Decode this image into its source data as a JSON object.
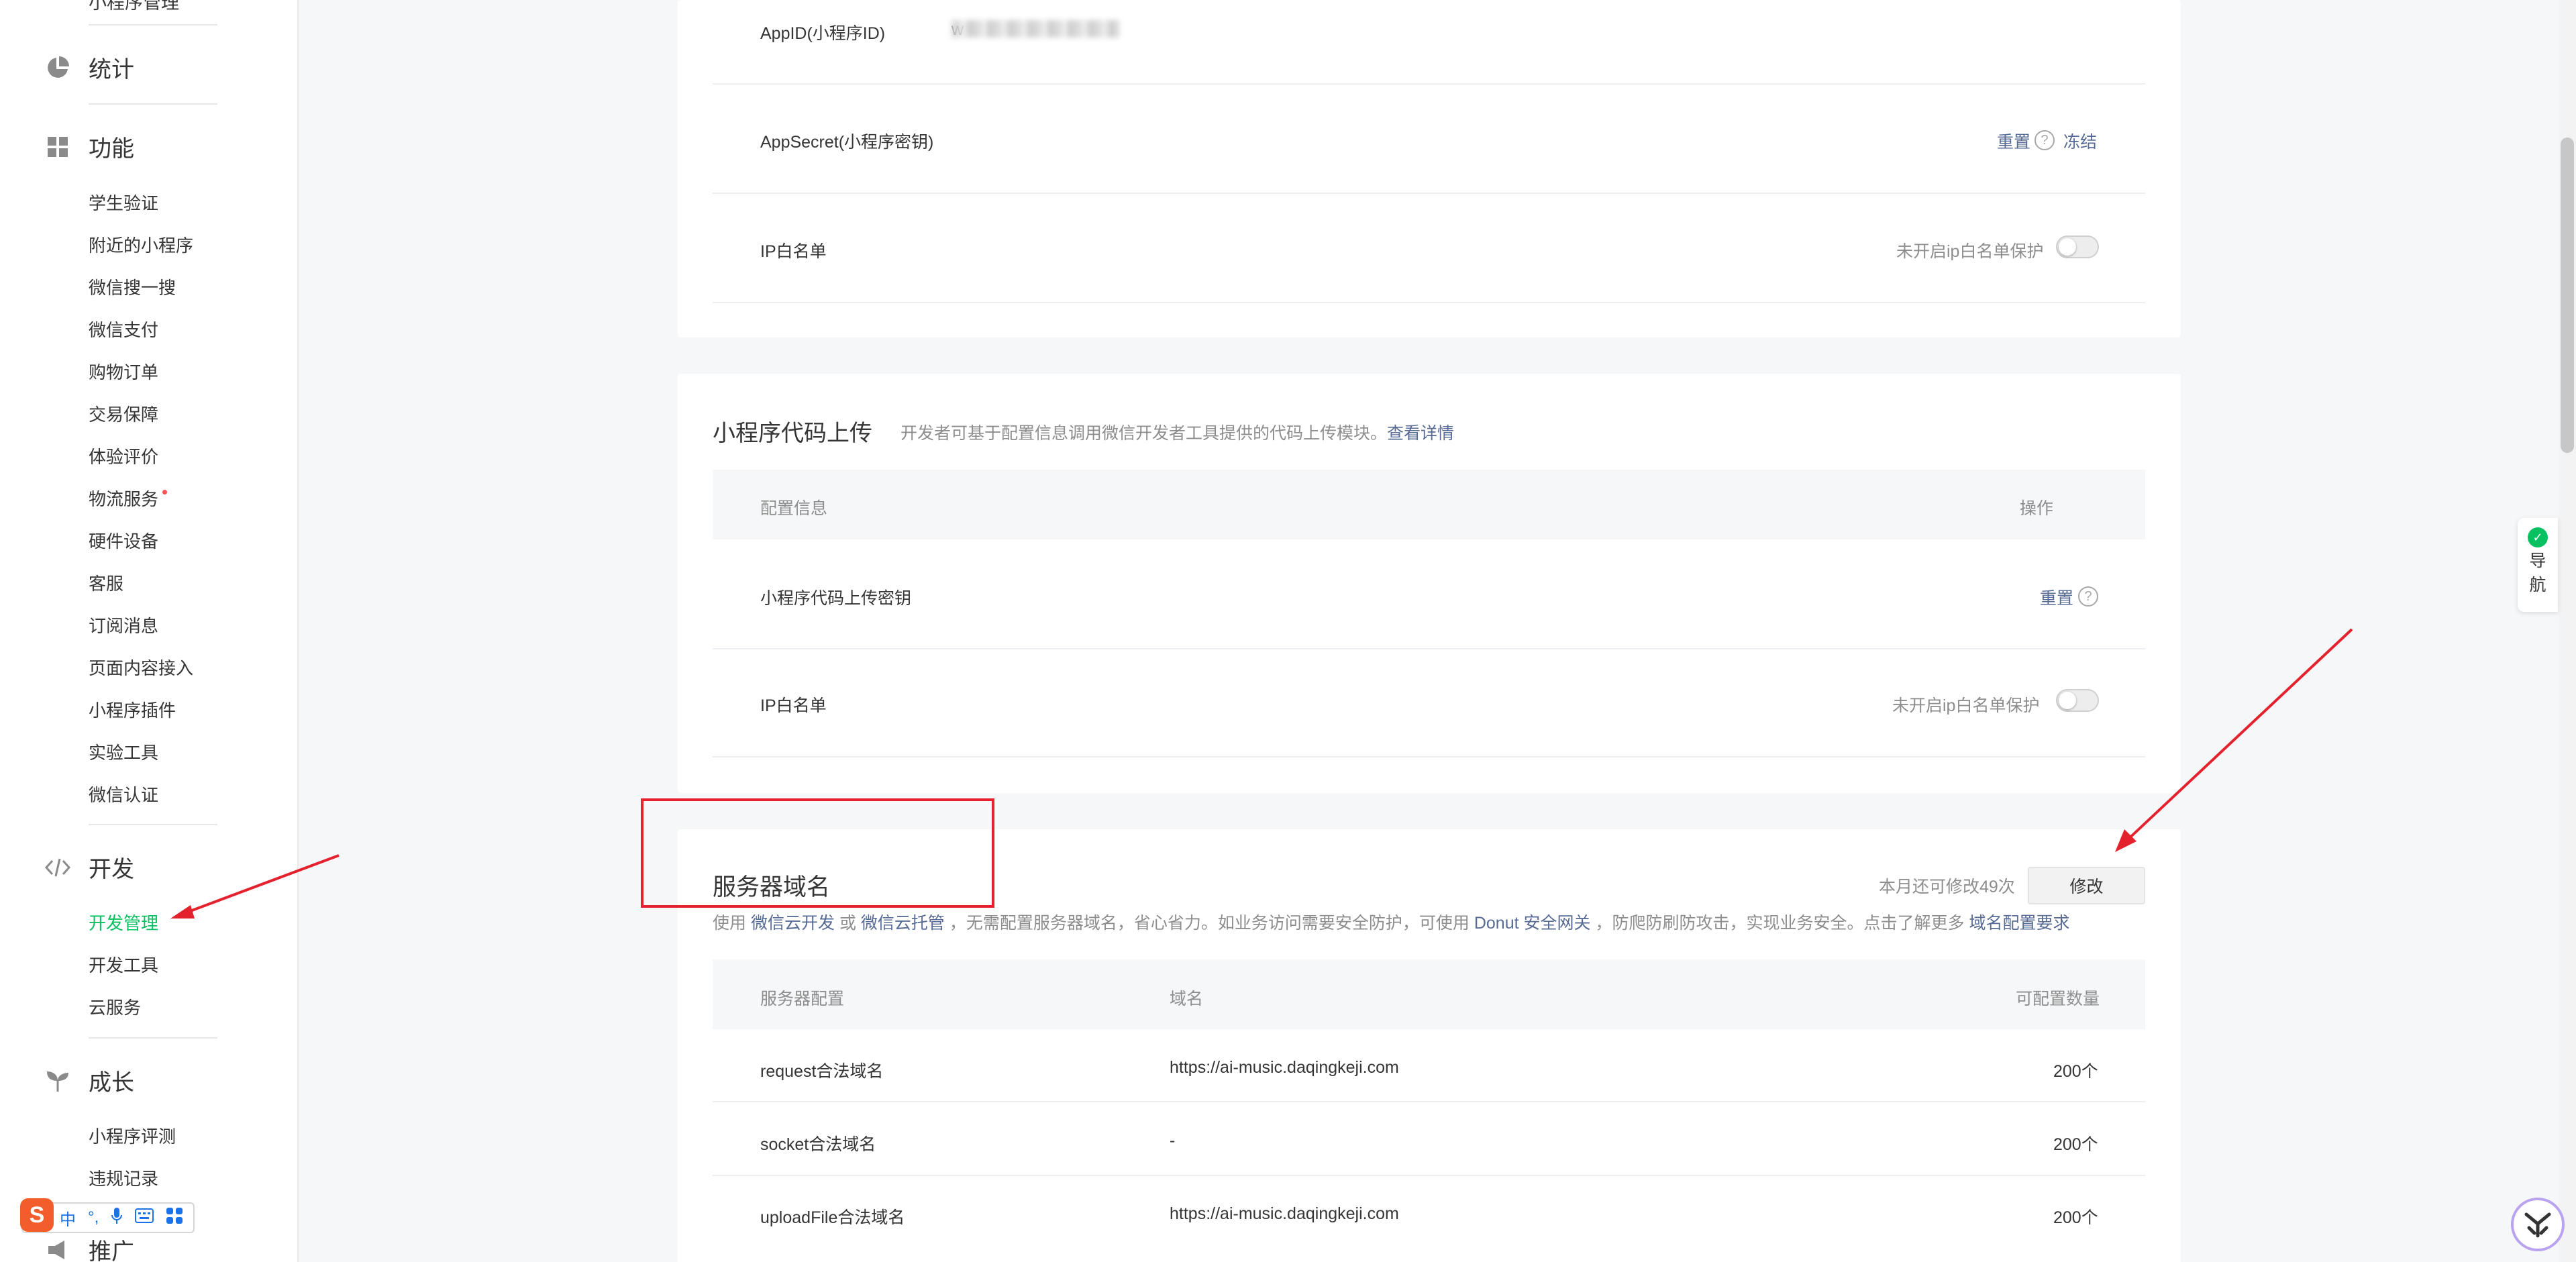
{
  "sidebar": {
    "cut_item": "小程序管理",
    "sections": {
      "stats": "统计",
      "features": "功能",
      "dev": "开发",
      "growth": "成长",
      "promo": "推广"
    },
    "feature_items": [
      "学生验证",
      "附近的小程序",
      "微信搜一搜",
      "微信支付",
      "购物订单",
      "交易保障",
      "体验评价",
      "物流服务",
      "硬件设备",
      "客服",
      "订阅消息",
      "页面内容接入",
      "小程序插件",
      "实验工具",
      "微信认证"
    ],
    "dev_items": [
      "开发管理",
      "开发工具",
      "云服务"
    ],
    "growth_items": [
      "小程序评测",
      "违规记录"
    ]
  },
  "ime": {
    "items": [
      "中",
      "°,",
      "mic",
      "kbd",
      "grid"
    ]
  },
  "app_settings": {
    "appid_label": "AppID(小程序ID)",
    "appid_prefix": "w",
    "appsecret_label": "AppSecret(小程序密钥)",
    "reset": "重置",
    "freeze": "冻结",
    "ip_label": "IP白名单",
    "ip_status": "未开启ip白名单保护"
  },
  "upload": {
    "title": "小程序代码上传",
    "desc": "开发者可基于配置信息调用微信开发者工具提供的代码上传模块。",
    "desc_link": "查看详情",
    "th_config": "配置信息",
    "th_action": "操作",
    "key_label": "小程序代码上传密钥",
    "reset": "重置",
    "ip_label": "IP白名单",
    "ip_status": "未开启ip白名单保护"
  },
  "server": {
    "title": "服务器域名",
    "remaining": "本月还可修改49次",
    "modify": "修改",
    "desc_1": "使用",
    "link_1": "微信云开发",
    "desc_2": "或",
    "link_2": "微信云托管",
    "desc_3": "，无需配置服务器域名，省心省力。如业务访问需要安全防护，可使用",
    "link_3": "Donut 安全网关",
    "desc_4": "，防爬防刷防攻击，实现业务安全。点击了解更多",
    "link_4": "域名配置要求",
    "th_config": "服务器配置",
    "th_domain": "域名",
    "th_count": "可配置数量",
    "rows": [
      {
        "name": "request合法域名",
        "domain": "https://ai-music.daqingkeji.com",
        "count": "200个"
      },
      {
        "name": "socket合法域名",
        "domain": "-",
        "count": "200个"
      },
      {
        "name": "uploadFile合法域名",
        "domain": "https://ai-music.daqingkeji.com",
        "count": "200个"
      }
    ]
  },
  "nav_widget": {
    "check": "✓",
    "line1": "导",
    "line2": "航"
  },
  "colors": {
    "accent": "#07c160",
    "link": "#576b95",
    "annotation": "#e4222d"
  }
}
